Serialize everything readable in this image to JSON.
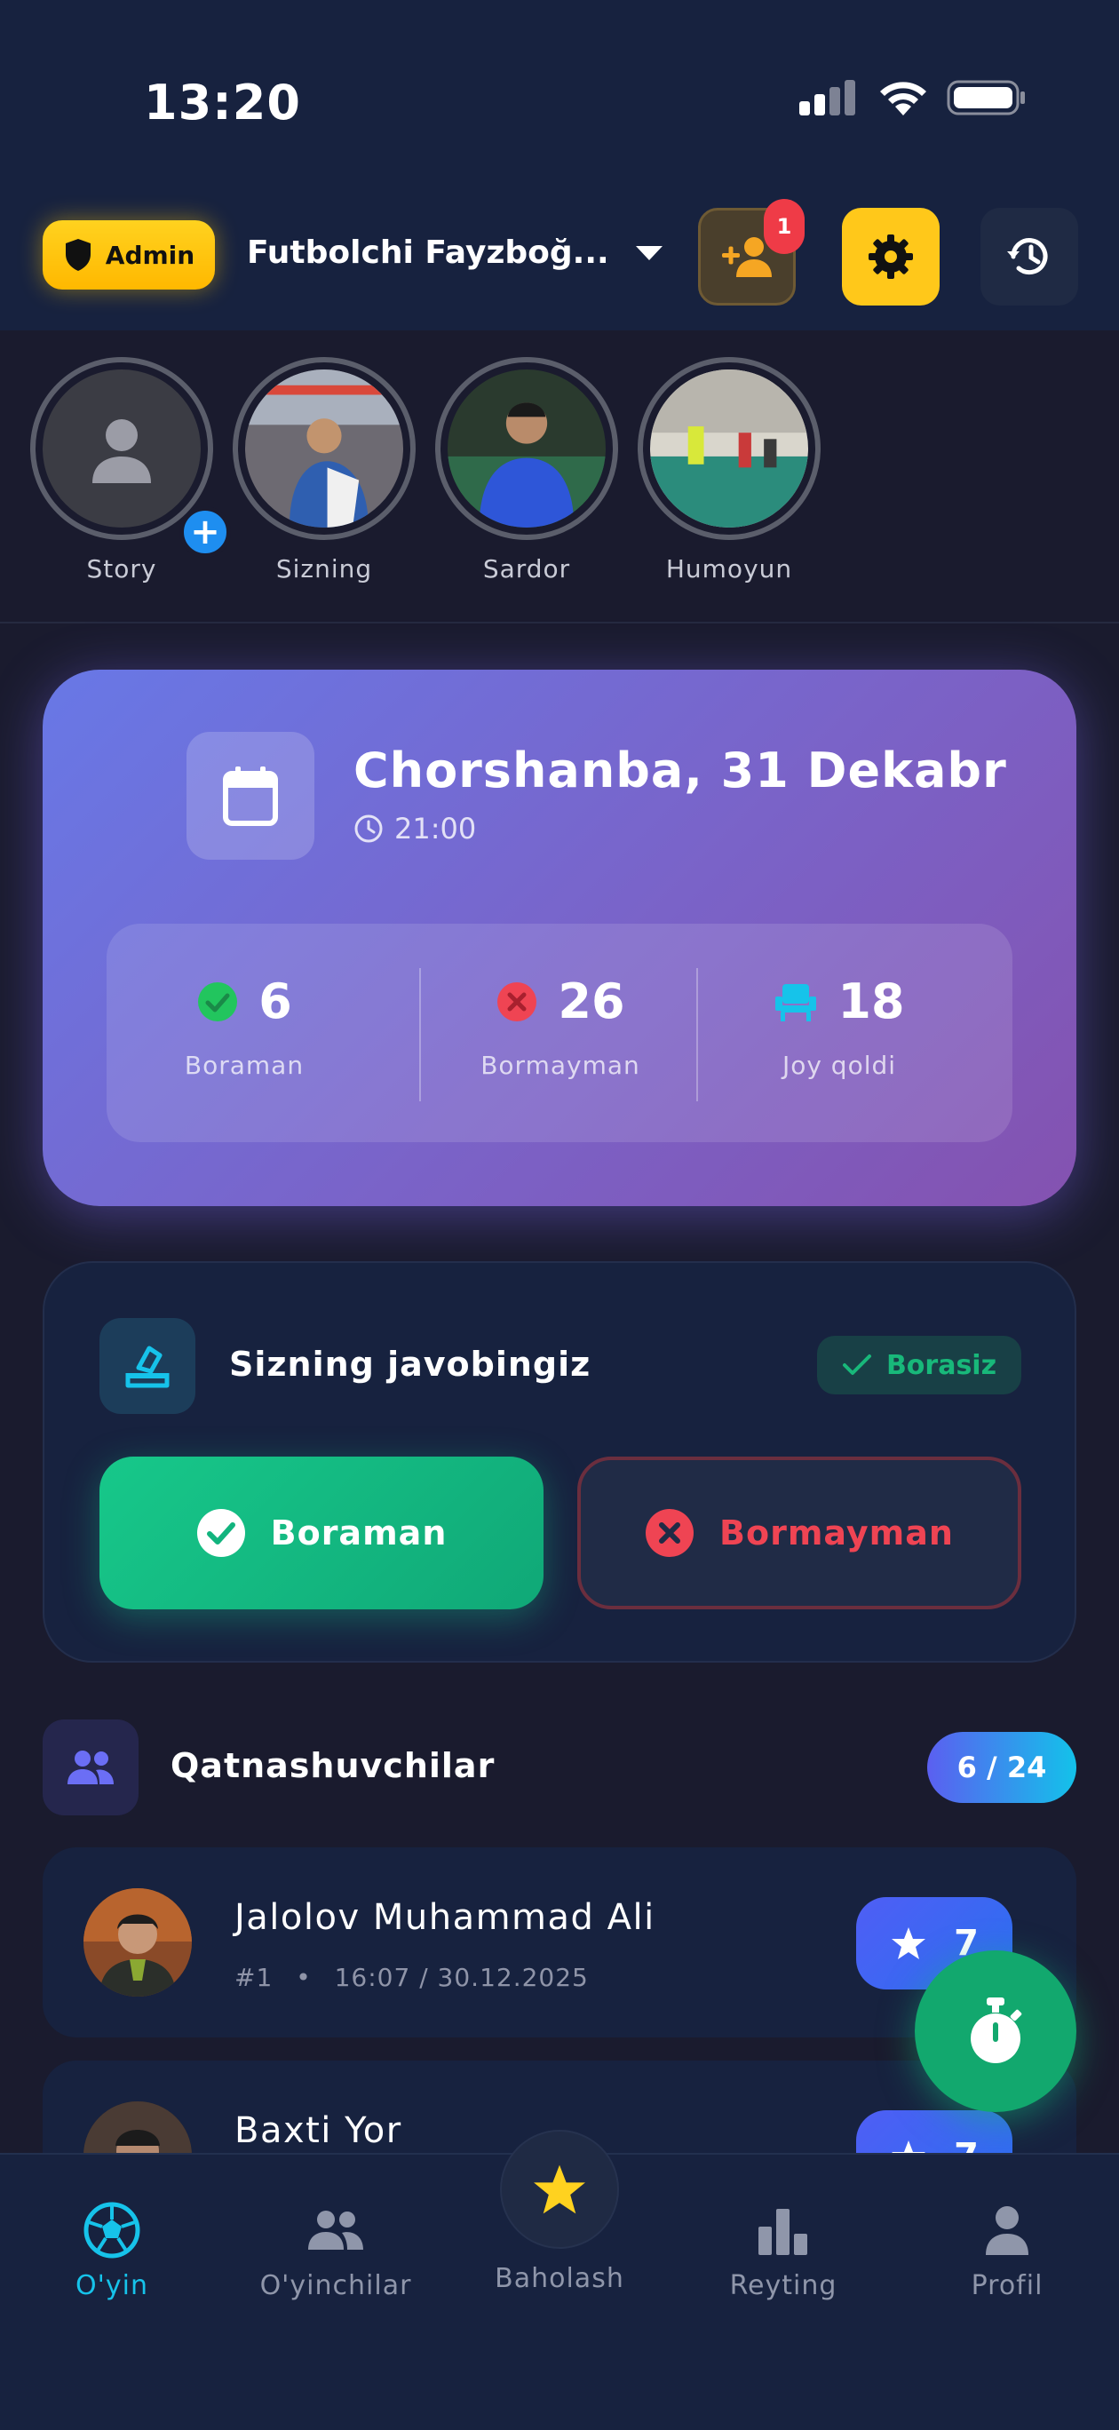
{
  "status_bar": {
    "time": "13:20"
  },
  "header": {
    "role_badge": "Admin",
    "team_name": "Futbolchi Fayzboğ...",
    "requests_count": "1"
  },
  "stories": [
    {
      "name": "Story"
    },
    {
      "name": "Sizning"
    },
    {
      "name": "Sardor"
    },
    {
      "name": "Humoyun"
    }
  ],
  "event": {
    "date": "Chorshanba, 31 Dekabr",
    "time": "21:00",
    "stats": [
      {
        "value": "6",
        "label": "Boraman",
        "color": "#22c55e"
      },
      {
        "value": "26",
        "label": "Bormayman",
        "color": "#ef4453"
      },
      {
        "value": "18",
        "label": "Joy qoldi",
        "color": "#16c3ea"
      }
    ]
  },
  "answer": {
    "title": "Sizning javobingiz",
    "status": "Borasiz",
    "yes_label": "Boraman",
    "no_label": "Bormayman"
  },
  "participants": {
    "title": "Qatnashuvchilar",
    "count": "6 / 24",
    "rows": [
      {
        "name": "Jalolov Muhammad Ali",
        "number": "#1",
        "meta": "16:07 / 30.12.2025",
        "rating": "7"
      },
      {
        "name": "Baxti Yor",
        "number": "",
        "meta": "",
        "rating": "7"
      }
    ]
  },
  "nav": {
    "items": [
      {
        "label": "O'yin",
        "icon": "soccer-ball-icon"
      },
      {
        "label": "O'yinchilar",
        "icon": "players-icon"
      },
      {
        "label": "Baholash",
        "icon": "star-icon"
      },
      {
        "label": "Reyting",
        "icon": "bar-chart-icon"
      },
      {
        "label": "Profil",
        "icon": "person-icon"
      }
    ]
  },
  "colors": {
    "accent_cyan": "#16c3ea",
    "accent_green": "#12a86e",
    "accent_yellow": "#ffc81a",
    "danger": "#ef4453"
  }
}
